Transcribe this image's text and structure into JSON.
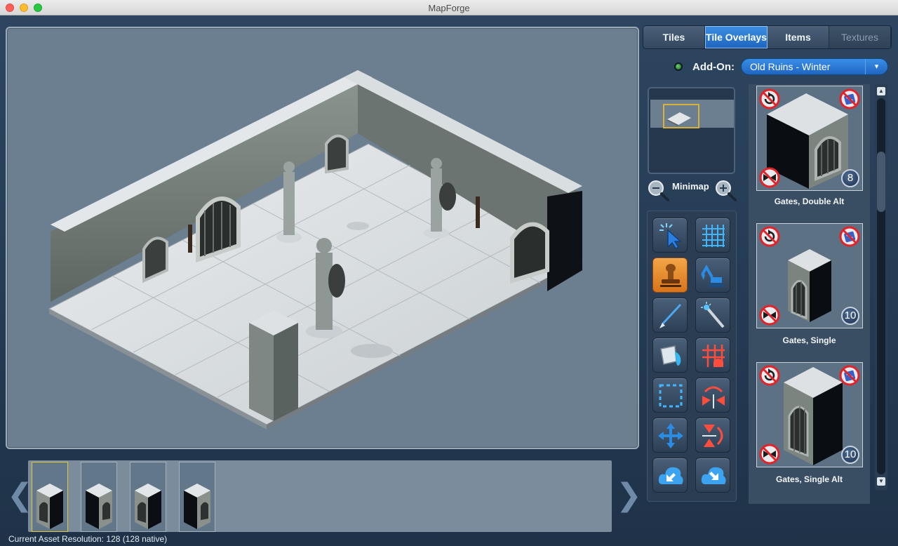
{
  "window": {
    "title": "MapForge"
  },
  "tabs": [
    {
      "label": "Tiles",
      "state": "normal"
    },
    {
      "label": "Tile Overlays",
      "state": "active"
    },
    {
      "label": "Items",
      "state": "normal"
    },
    {
      "label": "Textures",
      "state": "disabled"
    }
  ],
  "addon": {
    "label": "Add-On:",
    "selected": "Old Ruins - Winter",
    "caret": "▾"
  },
  "minimap": {
    "label": "Minimap"
  },
  "tools": [
    {
      "name": "select-tool",
      "icon": "select-cursor-icon",
      "active": false
    },
    {
      "name": "grid-tool",
      "icon": "grid-icon",
      "active": false
    },
    {
      "name": "stamp-tool",
      "icon": "stamp-icon",
      "active": true
    },
    {
      "name": "excavator-tool",
      "icon": "excavator-icon",
      "active": false
    },
    {
      "name": "brush-tool",
      "icon": "brush-icon",
      "active": false
    },
    {
      "name": "magic-wand-tool",
      "icon": "magic-wand-icon",
      "active": false
    },
    {
      "name": "paint-bucket-tool",
      "icon": "paint-bucket-icon",
      "active": false
    },
    {
      "name": "grid-erase-tool",
      "icon": "grid-erase-icon",
      "active": false
    },
    {
      "name": "marquee-tool",
      "icon": "marquee-icon",
      "active": false
    },
    {
      "name": "flip-horizontal-tool",
      "icon": "flip-horizontal-icon",
      "active": false
    },
    {
      "name": "move-tool",
      "icon": "move-arrows-icon",
      "active": false
    },
    {
      "name": "flip-vertical-tool",
      "icon": "flip-vertical-icon",
      "active": false
    },
    {
      "name": "cloud-import-tool",
      "icon": "cloud-import-icon",
      "active": false
    },
    {
      "name": "cloud-export-tool",
      "icon": "cloud-export-icon",
      "active": false
    }
  ],
  "assets": [
    {
      "name": "Gates, Double Alt",
      "count": "8"
    },
    {
      "name": "Gates, Single",
      "count": "10"
    },
    {
      "name": "Gates, Single Alt",
      "count": "10"
    }
  ],
  "filmstrip": {
    "thumbs": 4,
    "selected_index": 0
  },
  "status": {
    "text": "Current Asset Resolution:  128 (128 native)"
  },
  "colors": {
    "accent": "#2a7ad6",
    "active_tool": "#e88a2a",
    "canvas_bg": "#6b7f91",
    "panel_bg": "#2e4560"
  }
}
